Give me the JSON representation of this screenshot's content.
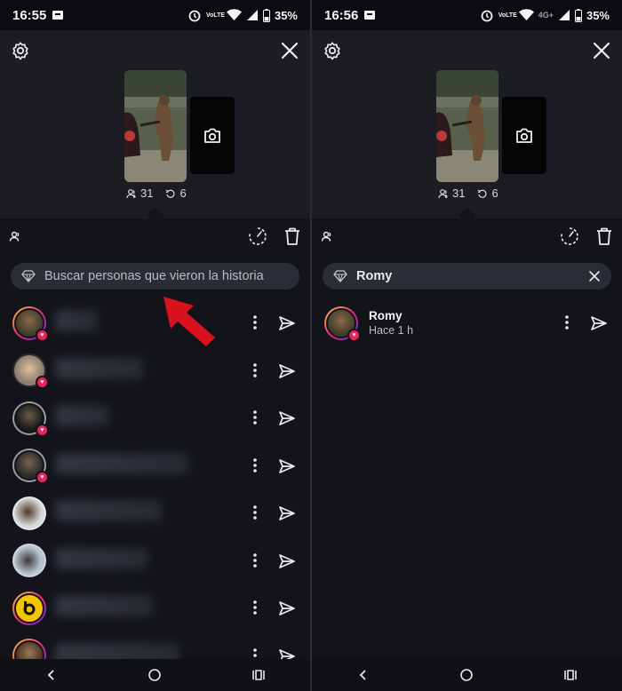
{
  "left": {
    "status": {
      "time": "16:55",
      "battery": "35%",
      "volte": "VoLTE",
      "net": ""
    },
    "stats": {
      "views": "31",
      "replays": "6"
    },
    "search": {
      "placeholder": "Buscar personas que vieron la historia",
      "value": ""
    },
    "viewers_count": 8
  },
  "right": {
    "status": {
      "time": "16:56",
      "battery": "35%",
      "volte": "VoLTE",
      "net": "4G+"
    },
    "stats": {
      "views": "31",
      "replays": "6"
    },
    "search": {
      "value": "Romy"
    },
    "result": {
      "name": "Romy",
      "time": "Hace 1 h"
    }
  },
  "colors": {
    "accent_heart": "#e8245a",
    "arrow": "#d8121e",
    "background": "#12141a"
  },
  "icons": [
    "gear-icon",
    "close-icon",
    "camera-icon",
    "viewers-icon",
    "replay-icon",
    "insights-icon",
    "trash-icon",
    "search-diamond-icon",
    "more-icon",
    "send-icon",
    "back-nav-icon",
    "home-nav-icon",
    "recents-nav-icon"
  ]
}
